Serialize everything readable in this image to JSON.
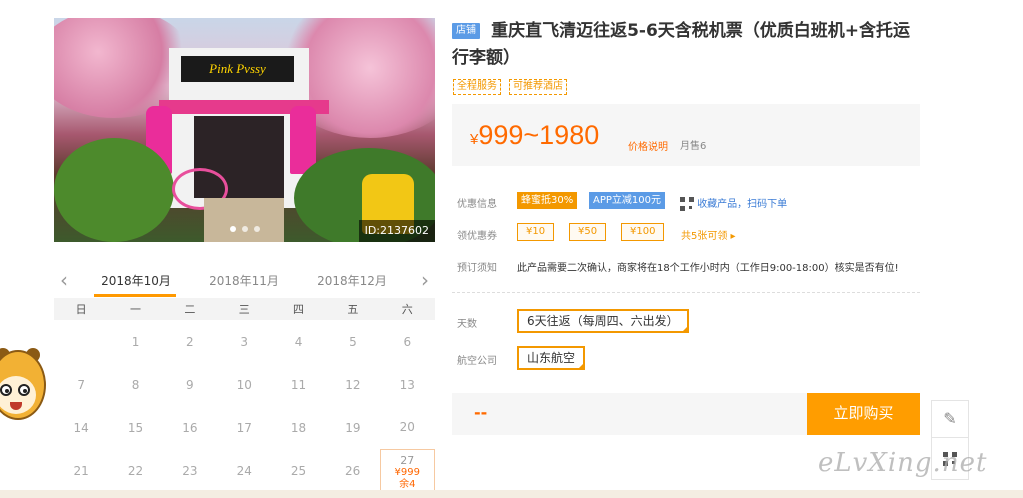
{
  "photo": {
    "id_label": "ID:2137602",
    "sign_text": "Pink Pvssy"
  },
  "calendar": {
    "months": [
      "2018年10月",
      "2018年11月",
      "2018年12月"
    ],
    "weekdays": [
      "日",
      "一",
      "二",
      "三",
      "四",
      "五",
      "六"
    ],
    "weeks": [
      [
        "",
        "1",
        "2",
        "3",
        "4",
        "5",
        "6"
      ],
      [
        "7",
        "8",
        "9",
        "10",
        "11",
        "12",
        "13"
      ],
      [
        "14",
        "15",
        "16",
        "17",
        "18",
        "19",
        "20"
      ],
      [
        "21",
        "22",
        "23",
        "24",
        "25",
        "26",
        "27"
      ]
    ],
    "available_day": {
      "day": "27",
      "price": "¥999",
      "remaining": "余4"
    }
  },
  "product": {
    "shop_badge": "店铺",
    "title": "重庆直飞清迈往返5-6天含税机票（优质白班机+含托运行李额）",
    "tags": [
      "全程服务",
      "可推荐酒店"
    ],
    "price": {
      "symbol": "¥",
      "range": "999~1980",
      "explain": "价格说明",
      "sold": "月售6"
    }
  },
  "promo": {
    "label": "优惠信息",
    "pills": [
      {
        "text": "蜂蜜抵30%",
        "color": "#f39800"
      },
      {
        "text": "APP立减100元",
        "color": "#5b9be6"
      }
    ],
    "link_text": "收藏产品，扫码下单"
  },
  "coupons": {
    "label": "领优惠券",
    "items": [
      "¥10",
      "¥50",
      "¥100"
    ],
    "more": "共5张可领 ▸"
  },
  "notice": {
    "label": "预订须知",
    "text": "此产品需要二次确认，商家将在18个工作小时内（工作日9:00-18:00）核实是否有位!"
  },
  "options": {
    "days_label": "天数",
    "days_value": "6天往返（每周四、六出发）",
    "airline_label": "航空公司",
    "airline_value": "山东航空"
  },
  "buy": {
    "placeholder": "--",
    "button": "立即购买"
  },
  "watermark": "eLvXing.net"
}
